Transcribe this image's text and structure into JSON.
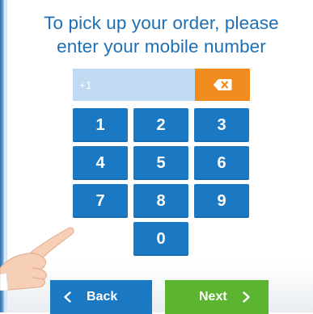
{
  "prompt": {
    "line1": "To pick up your order, please",
    "line2": "enter your mobile number"
  },
  "phone": {
    "prefix": "+1",
    "number": ""
  },
  "keypad": {
    "keys": [
      "1",
      "2",
      "3",
      "4",
      "5",
      "6",
      "7",
      "8",
      "9",
      "0"
    ]
  },
  "nav": {
    "back_label": "Back",
    "next_label": "Next"
  },
  "icons": {
    "backspace": "backspace-icon",
    "back": "chevron-left-icon",
    "next": "chevron-right-icon",
    "hand": "pointing-hand-icon"
  },
  "colors": {
    "heading": "#1f6fb3",
    "key": "#1b78c3",
    "field": "#bfdaf1",
    "backspace": "#f28c1f",
    "next": "#5cb531"
  }
}
